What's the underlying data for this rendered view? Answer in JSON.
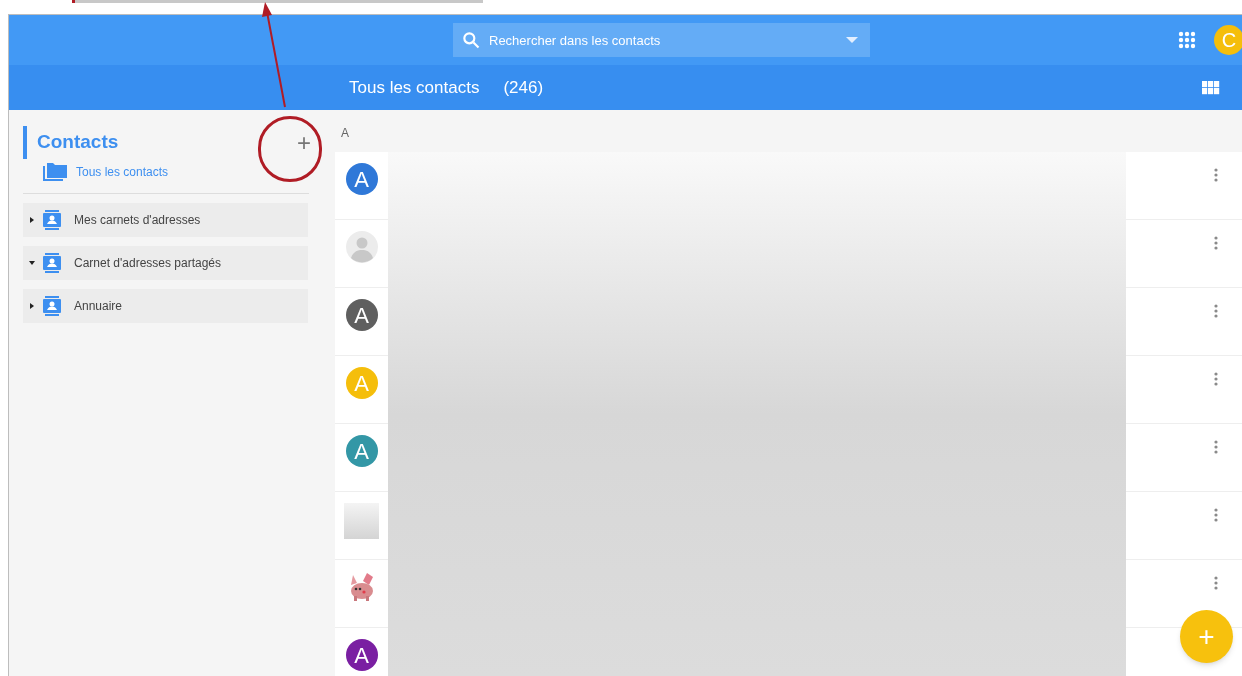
{
  "header": {
    "search": {
      "placeholder": "Rechercher dans les contacts"
    },
    "user_initial": "C"
  },
  "subheader": {
    "title": "Tous les contacts",
    "count": "(246)"
  },
  "sidebar": {
    "title": "Contacts",
    "add_label": "+",
    "all_contacts": {
      "label": "Tous les contacts",
      "selected": true
    },
    "books": [
      {
        "label": "Mes carnets d'adresses",
        "expanded": false
      },
      {
        "label": "Carnet d'adresses partagés",
        "expanded": true
      },
      {
        "label": "Annuaire",
        "expanded": false
      }
    ]
  },
  "list": {
    "section": "A",
    "contacts": [
      {
        "kind": "letter",
        "letter": "A",
        "color": "#2f78d8"
      },
      {
        "kind": "silhouette"
      },
      {
        "kind": "letter",
        "letter": "A",
        "color": "#5f5f5f"
      },
      {
        "kind": "letter",
        "letter": "A",
        "color": "#f5be0b"
      },
      {
        "kind": "letter",
        "letter": "A",
        "color": "#3397a6"
      },
      {
        "kind": "photo"
      },
      {
        "kind": "creature"
      },
      {
        "kind": "letter",
        "letter": "A",
        "color": "#7a1fa2"
      }
    ]
  },
  "fab": {
    "label": "+"
  }
}
